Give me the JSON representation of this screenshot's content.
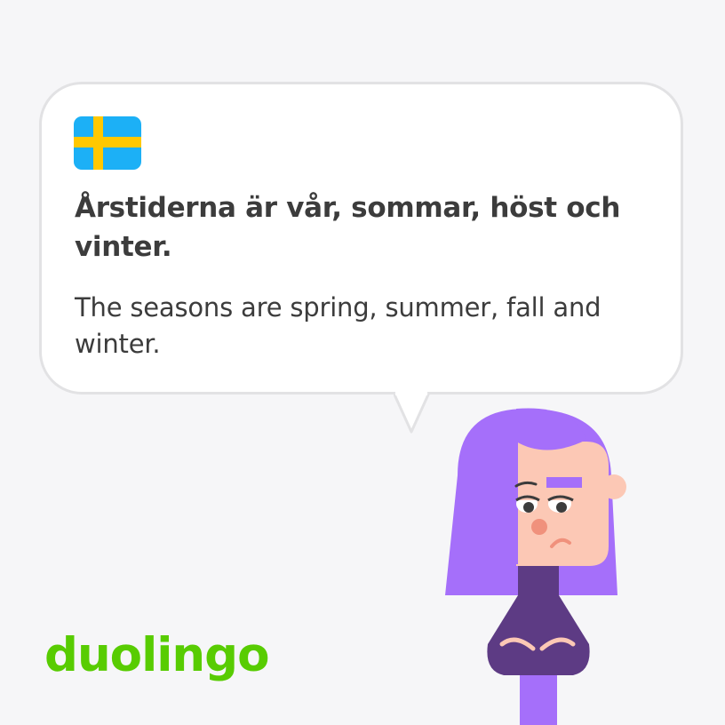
{
  "card": {
    "language_flag_icon": "sweden-flag-icon",
    "sentence": "Årstiderna är vår, sommar, höst och vinter.",
    "translation": "The seasons are spring, summer, fall and winter."
  },
  "brand": {
    "logo_text": "duolingo",
    "logo_color": "#58cc02"
  },
  "character": {
    "icon": "lily-character-icon",
    "hair_color": "#a56ffa",
    "shirt_color": "#5d3b84",
    "skin_color": "#fcc8b5"
  },
  "colors": {
    "background": "#f6f6f8",
    "bubble": "#ffffff",
    "bubble_border": "#e2e2e4",
    "text": "#3c3c3c",
    "flag_blue": "#1cb0f6",
    "flag_yellow": "#ffc800"
  }
}
